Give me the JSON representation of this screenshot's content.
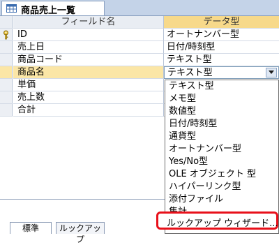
{
  "tab": {
    "title": "商品売上一覧",
    "icon": "table-icon"
  },
  "grid": {
    "header": {
      "field_name": "フィールド名",
      "data_type": "データ型"
    },
    "rows": [
      {
        "field": "ID",
        "type": "オートナンバー型",
        "primary_key": true
      },
      {
        "field": "売上日",
        "type": "日付/時刻型"
      },
      {
        "field": "商品コード",
        "type": "テキスト型"
      },
      {
        "field": "商品名",
        "type": "テキスト型",
        "current": true
      },
      {
        "field": "単価",
        "type": ""
      },
      {
        "field": "売上数",
        "type": ""
      },
      {
        "field": "合計",
        "type": ""
      }
    ]
  },
  "dropdown": {
    "options": [
      "テキスト型",
      "メモ型",
      "数値型",
      "日付/時刻型",
      "通貨型",
      "オートナンバー型",
      "Yes/No型",
      "OLE オブジェクト 型",
      "ハイパーリンク型",
      "添付ファイル",
      "集計",
      "ルックアップ ウィザード..."
    ],
    "highlighted": "ルックアップ ウィザード..."
  },
  "properties": {
    "tabs": [
      "標準",
      "ルックアップ"
    ]
  },
  "colors": {
    "highlight_border": "#e8101a",
    "current_row": "#fbe6a6",
    "header_active": "#f7d98a"
  }
}
